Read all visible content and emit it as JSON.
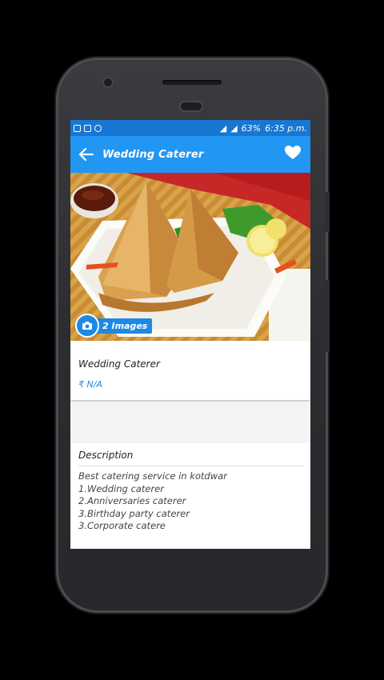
{
  "status_bar": {
    "battery": "63%",
    "time": "6:35 p.m."
  },
  "app_bar": {
    "title": "Wedding Caterer"
  },
  "hero": {
    "images_label": "2 Images"
  },
  "listing": {
    "title": "Wedding Caterer",
    "price": "₹ N/A"
  },
  "description": {
    "heading": "Description",
    "lines": [
      "Best catering service in kotdwar",
      "1.Wedding caterer",
      "2.Anniversaries caterer",
      "3.Birthday party caterer",
      "3.Corporate catere"
    ]
  },
  "colors": {
    "status_bar": "#1976d2",
    "app_bar": "#2196f3",
    "price": "#1e88e5"
  }
}
